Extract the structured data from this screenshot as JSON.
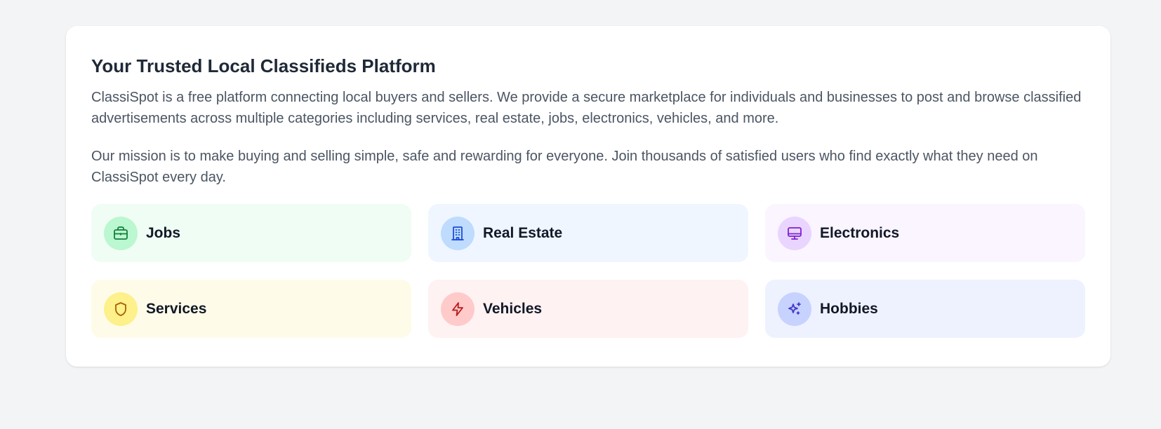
{
  "about": {
    "title": "Your Trusted Local Classifieds Platform",
    "paragraph1": "ClassiSpot is a free platform connecting local buyers and sellers. We provide a secure marketplace for individuals and businesses to post and browse classified advertisements across multiple categories including services, real estate, jobs, electronics, vehicles, and more.",
    "paragraph2": "Our mission is to make buying and selling simple, safe and rewarding for everyone. Join thousands of satisfied users who find exactly what they need on ClassiSpot every day."
  },
  "categories": [
    {
      "label": "Jobs",
      "icon": "briefcase-icon",
      "bg": "#f0fdf4",
      "circle": "#bbf7d0",
      "stroke": "#15803d"
    },
    {
      "label": "Real Estate",
      "icon": "building-icon",
      "bg": "#eff6ff",
      "circle": "#bfdbfe",
      "stroke": "#1d4ed8"
    },
    {
      "label": "Electronics",
      "icon": "monitor-icon",
      "bg": "#faf5ff",
      "circle": "#e9d5ff",
      "stroke": "#7e22ce"
    },
    {
      "label": "Services",
      "icon": "shield-icon",
      "bg": "#fefce8",
      "circle": "#fef08a",
      "stroke": "#a16207"
    },
    {
      "label": "Vehicles",
      "icon": "lightning-icon",
      "bg": "#fef2f2",
      "circle": "#fecaca",
      "stroke": "#b91c1c"
    },
    {
      "label": "Hobbies",
      "icon": "sparkles-icon",
      "bg": "#eef2ff",
      "circle": "#c7d2fe",
      "stroke": "#4338ca"
    }
  ]
}
